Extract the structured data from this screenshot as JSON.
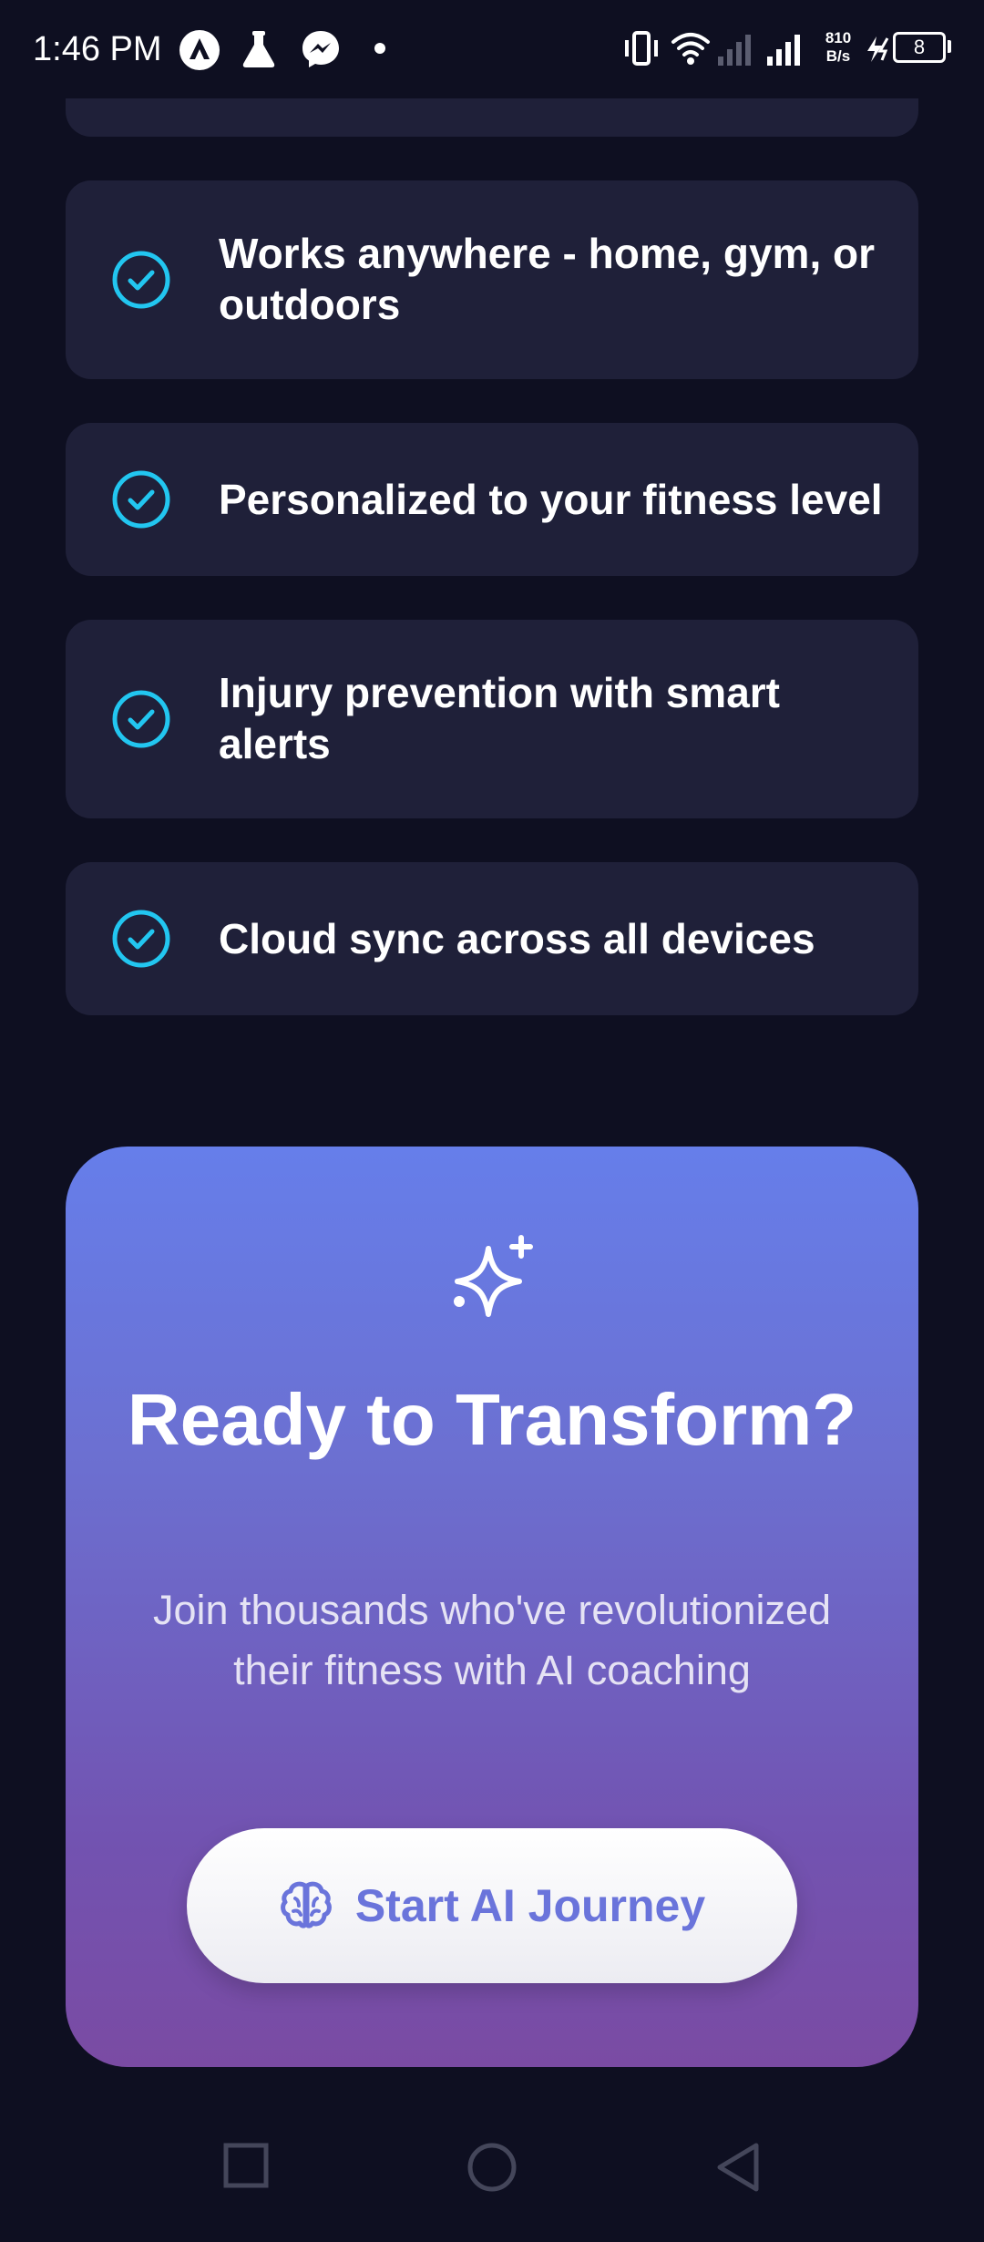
{
  "status_bar": {
    "time": "1:46 PM",
    "net_speed_value": "810",
    "net_speed_unit": "B/s",
    "battery": "8"
  },
  "features": [
    {
      "text": "Works anywhere - home, gym, or outdoors"
    },
    {
      "text": "Personalized to your fitness level"
    },
    {
      "text": "Injury prevention with smart alerts"
    },
    {
      "text": "Cloud sync across all devices"
    }
  ],
  "cta": {
    "title": "Ready to Transform?",
    "subtitle": "Join thousands who've revolutionized their fitness with AI coaching",
    "button_label": "Start AI Journey",
    "button_icon": "brain-icon",
    "header_icon": "sparkle-icon"
  },
  "colors": {
    "background": "#0e0f21",
    "card": "#1f2039",
    "check_accent": "#22c6f0",
    "gradient_top": "#667eea",
    "gradient_bottom": "#7a4ba3",
    "button_text": "#6a74db"
  },
  "nav": {
    "icons": [
      "recents-square-icon",
      "home-circle-icon",
      "back-triangle-icon"
    ]
  }
}
